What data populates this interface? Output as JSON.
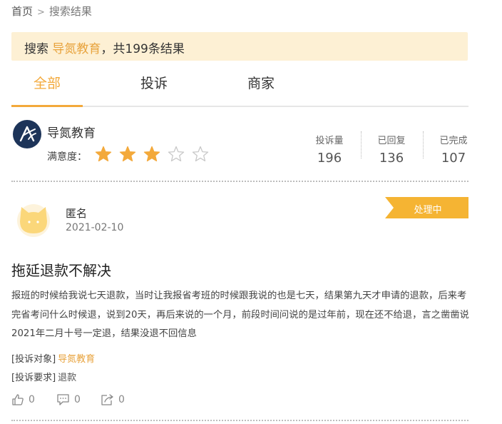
{
  "breadcrumb": {
    "home": "首页",
    "separator": ">",
    "current": "搜索结果"
  },
  "search_banner": {
    "prefix": "搜索",
    "keyword": "导氮教育",
    "suffix": "，共199条结果"
  },
  "tabs": [
    {
      "label": "全部",
      "active": true
    },
    {
      "label": "投诉"
    },
    {
      "label": "商家"
    }
  ],
  "merchant": {
    "name": "导氮教育",
    "satisfaction_label": "满意度：",
    "rating": 3,
    "rating_max": 5,
    "stats": [
      {
        "label": "投诉量",
        "value": "196"
      },
      {
        "label": "已回复",
        "value": "136"
      },
      {
        "label": "已完成",
        "value": "107"
      }
    ]
  },
  "complaint": {
    "user": "匿名",
    "date": "2021-02-10",
    "status": "处理中",
    "title": "拖延退款不解决",
    "body": "报班的时候给我说七天退款，当时让我报省考班的时候跟我说的也是七天，结果第九天才申请的退款，后来考完省考问什么时候退，说到20天，再后来说的一个月，前段时间问说的是过年前，现在还不给退，言之凿凿说2021年二月十号一定退，结果没退不回信息",
    "target_label": "[投诉对象]",
    "target_value": "导氮教育",
    "request_label": "[投诉要求]",
    "request_value": "退款",
    "likes": "0",
    "comments": "0",
    "shares": "0"
  },
  "colors": {
    "accent": "#f3a93b",
    "banner_bg": "#fdf0d4",
    "logo_bg": "#1d3459"
  }
}
